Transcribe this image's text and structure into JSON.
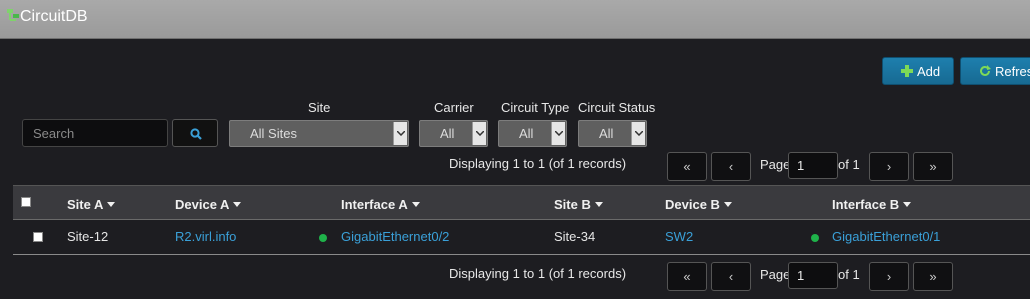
{
  "app": {
    "title": "CircuitDB",
    "logo_icon": "circuit-logo-icon"
  },
  "toolbar": {
    "add_label": "Add",
    "refresh_label": "Refresh"
  },
  "filters": {
    "search_placeholder": "Search",
    "site_label": "Site",
    "site_value": "All Sites",
    "carrier_label": "Carrier",
    "carrier_value": "All",
    "circuit_type_label": "Circuit Type",
    "circuit_type_value": "All",
    "circuit_status_label": "Circuit Status",
    "circuit_status_value": "All"
  },
  "pagination": {
    "display_text": "Displaying 1 to 1 (of 1 records)",
    "first_label": "«",
    "prev_label": "‹",
    "next_label": "›",
    "last_label": "»",
    "page_label": "Page",
    "page_value": "1",
    "of_label": "of 1"
  },
  "table": {
    "headers": [
      "Site A",
      "Device A",
      "Interface A",
      "Site B",
      "Device B",
      "Interface B"
    ],
    "rows": [
      {
        "site_a": "Site-12",
        "device_a": "R2.virl.info",
        "interface_a": "GigabitEthernet0/2",
        "site_b": "Site-34",
        "device_b": "SW2",
        "interface_b": "GigabitEthernet0/1",
        "status_color": "#1fb24a"
      }
    ]
  },
  "colors": {
    "accent": "#1e7fae",
    "link": "#3aa0d8",
    "status_up": "#1fb24a"
  }
}
